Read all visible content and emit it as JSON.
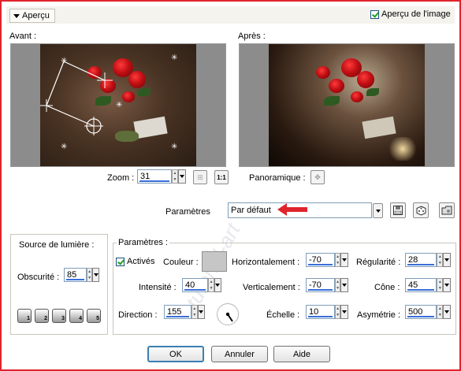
{
  "header": {
    "collapse_label": "Aperçu",
    "preview_checkbox_label": "Aperçu de l'image",
    "preview_checked": true
  },
  "previews": {
    "before_label": "Avant :",
    "after_label": "Après :"
  },
  "zoom": {
    "label": "Zoom :",
    "value": "31",
    "fit_icon": "fit-icon",
    "actual_size_label": "1:1"
  },
  "pan": {
    "label": "Panoramique :"
  },
  "presets": {
    "label": "Paramètres",
    "value": "Par défaut"
  },
  "light_source": {
    "title": "Source de lumière :",
    "darkness_label": "Obscurité :",
    "darkness_value": "85",
    "buttons": [
      "1",
      "2",
      "3",
      "4",
      "5"
    ]
  },
  "params": {
    "title": "Paramètres :",
    "enabled_label": "Activés",
    "enabled_checked": true,
    "color_label": "Couleur :",
    "color": "#c6c6c6",
    "intensity_label": "Intensité :",
    "intensity_value": "40",
    "direction_label": "Direction :",
    "direction_value": "155",
    "horizontal_label": "Horizontalement :",
    "horizontal_value": "-70",
    "vertical_label": "Verticalement :",
    "vertical_value": "-70",
    "scale_label": "Échelle :",
    "scale_value": "10",
    "regularity_label": "Régularité :",
    "regularity_value": "28",
    "cone_label": "Cône :",
    "cone_value": "45",
    "asymmetry_label": "Asymétrie :",
    "asymmetry_value": "500"
  },
  "footer": {
    "ok_label": "OK",
    "cancel_label": "Annuler",
    "help_label": "Aide"
  },
  "watermark_text": "tutoriel-art",
  "accent_color": "#e0242c"
}
